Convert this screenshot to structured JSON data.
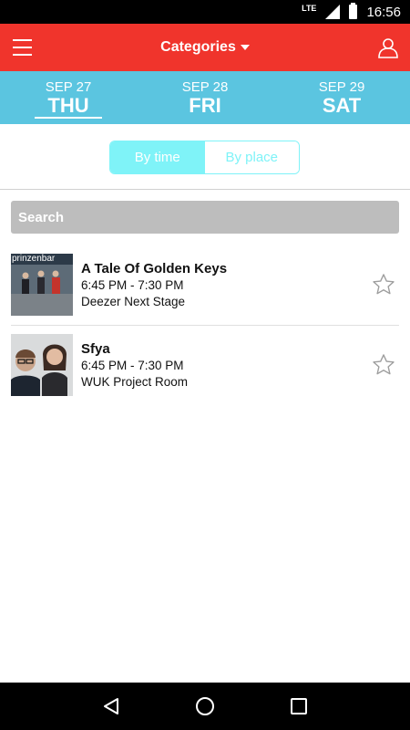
{
  "status_bar": {
    "network": "LTE",
    "time": "16:56"
  },
  "app_bar": {
    "title": "Categories",
    "menu_icon": "hamburger-icon",
    "profile_icon": "user-icon"
  },
  "colors": {
    "app_bar": "#f0342c",
    "date_bar": "#5bc5e0",
    "toggle_accent": "#7ff3f8",
    "search_bg": "#bdbdbd"
  },
  "dates": [
    {
      "month": "SEP 27",
      "day": "THU",
      "active": true
    },
    {
      "month": "SEP 28",
      "day": "FRI",
      "active": false
    },
    {
      "month": "SEP 29",
      "day": "SAT",
      "active": false
    }
  ],
  "toggle": {
    "by_time": "By time",
    "by_place": "By place",
    "selected": "by_time"
  },
  "search": {
    "placeholder": "Search"
  },
  "events": [
    {
      "name": "A Tale Of Golden Keys",
      "time": "6:45 PM - 7:30 PM",
      "venue": "Deezer Next Stage",
      "image_sign": "prinzenbar",
      "starred": false
    },
    {
      "name": "Sfya",
      "time": "6:45 PM - 7:30 PM",
      "venue": "WUK Project Room",
      "starred": false
    }
  ]
}
